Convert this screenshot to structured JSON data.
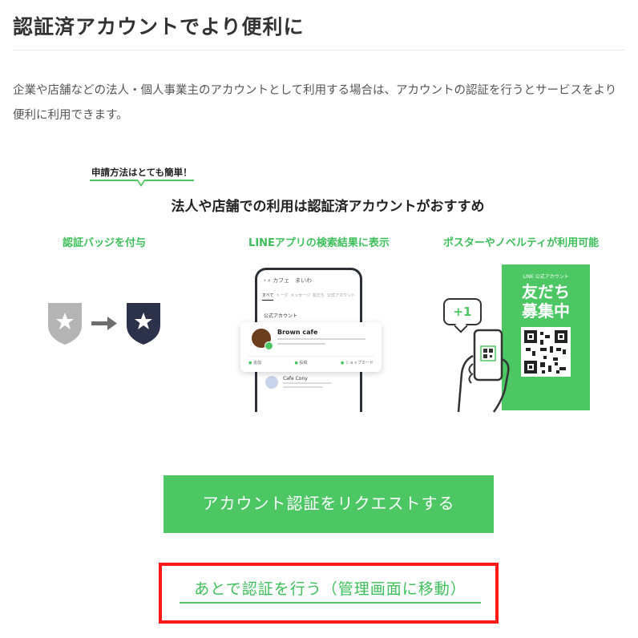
{
  "page": {
    "title": "認証済アカウントでより便利に",
    "description": "企業や店舗などの法人・個人事業主のアカウントとして利用する場合は、アカウントの認証を行うとサービスをより便利に利用できます。"
  },
  "promo": {
    "callout": "申請方法はとても簡単！",
    "subheading": "法人や店舗での利用は認証済アカウントがおすすめ",
    "features": [
      {
        "label": "認証バッジを付与"
      },
      {
        "label": "LINEアプリの検索結果に表示"
      },
      {
        "label": "ポスターやノベルティが利用可能"
      }
    ],
    "phone": {
      "search_query": "カフェ　まいわ",
      "tabs": [
        "すべて",
        "トーク",
        "メッセージ",
        "友だち",
        "公式アカウント"
      ],
      "section": "公式アカウント",
      "card_name": "Brown cafe",
      "card_actions": [
        "追加",
        "投稿",
        "ショップカード"
      ],
      "second_name": "Cafe Cony"
    },
    "plus_badge": "+1",
    "poster": {
      "top_text": "LINE 公式アカウント",
      "main_line1": "友だち",
      "main_line2": "募集中"
    }
  },
  "actions": {
    "request_label": "アカウント認証をリクエストする",
    "later_label": "あとで認証を行う（管理画面に移動）"
  },
  "colors": {
    "brand_green": "#4cc764",
    "highlight_red": "#ff1a1a",
    "badge_gray": "#b4b4b4",
    "badge_navy": "#2b3249"
  }
}
